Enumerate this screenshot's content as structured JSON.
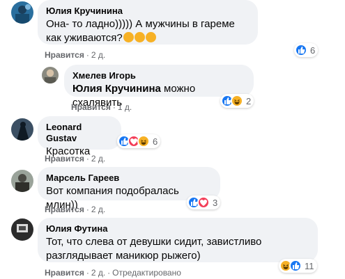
{
  "comments": [
    {
      "author": "Юлия Кручинина",
      "text": "Она- то ладно))))) А мужчины в гареме как уживаются?",
      "like_label": "Нравится",
      "time": "2 д.",
      "reaction_count": "6",
      "reactions": [
        "like"
      ],
      "inline_emojis": [
        "rofl",
        "rofl",
        "rofl"
      ]
    },
    {
      "author": "Хмелев Игорь",
      "mention": "Юлия Кручинина",
      "text": "можно схалявить",
      "like_label": "Нравится",
      "time": "1 д.",
      "reaction_count": "2",
      "reactions": [
        "like",
        "haha"
      ]
    },
    {
      "author": "Leonard Gustav",
      "text": "Красотка",
      "like_label": "Нравится",
      "time": "2 д.",
      "reaction_count": "6",
      "reactions": [
        "like",
        "love",
        "haha"
      ]
    },
    {
      "author": "Марсель Гареев",
      "text": "Вот компания подобралась млин))",
      "like_label": "Нравится",
      "time": "2 д.",
      "reaction_count": "3",
      "reactions": [
        "like",
        "love"
      ]
    },
    {
      "author": "Юлия Футина",
      "text": "Тот, что слева от девушки сидит, завистливо разглядывает маникюр рыжего)",
      "like_label": "Нравится",
      "time": "2 д.",
      "edited": "Отредактировано",
      "reaction_count": "11",
      "reactions": [
        "haha",
        "like"
      ]
    }
  ],
  "colors": {
    "bubble": "#f0f2f5",
    "meta": "#65676b",
    "like": "#1877f2",
    "love": "#f33e58",
    "haha": "#f7b125"
  }
}
